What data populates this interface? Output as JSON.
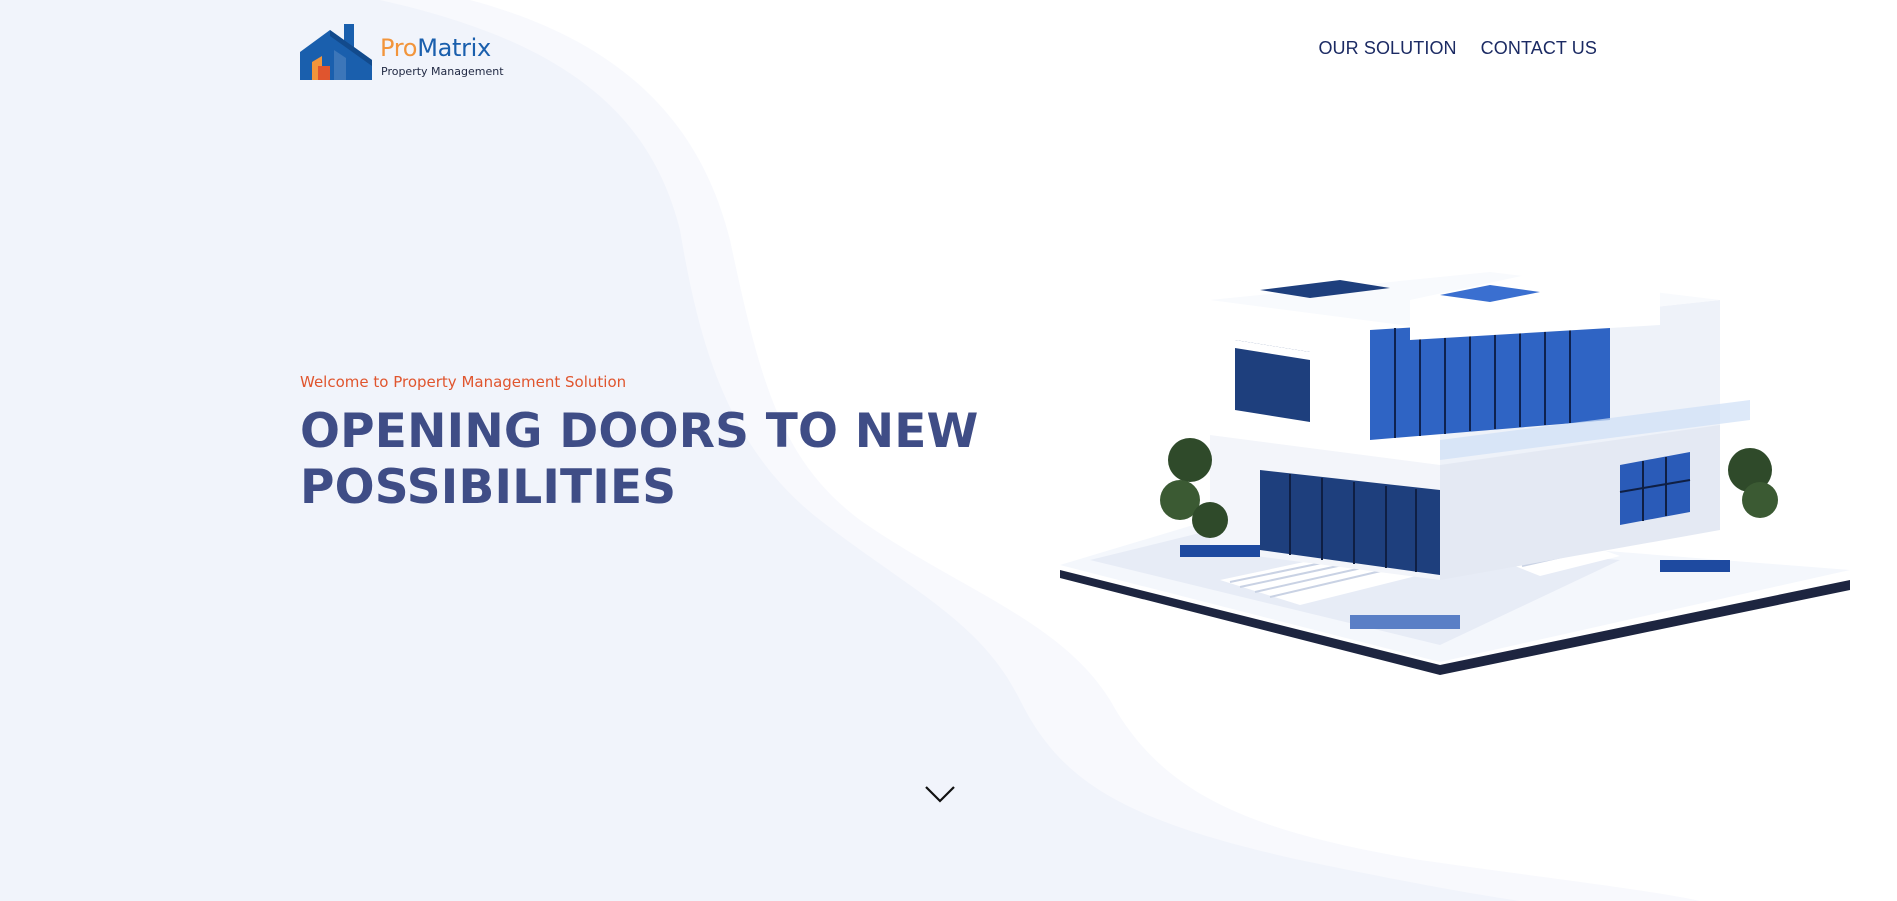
{
  "brand": {
    "name_part1": "Pro",
    "name_part2": "Matrix",
    "tagline": "Property Management",
    "colors": {
      "orange": "#f2953b",
      "blue": "#1a5fad",
      "navy": "#1b2a63",
      "headline": "#3f4d86",
      "accent_red": "#e0552e",
      "wave_light": "#f1f4fb"
    }
  },
  "nav": {
    "items": [
      {
        "label": "OUR SOLUTION"
      },
      {
        "label": "CONTACT US"
      }
    ]
  },
  "hero": {
    "eyebrow": "Welcome to Property Management Solution",
    "headline_line1": "OPENING DOORS TO NEW",
    "headline_line2": "POSSIBILITIES",
    "image_subject": "isometric-modern-house",
    "scroll_icon": "chevron-down-icon"
  }
}
